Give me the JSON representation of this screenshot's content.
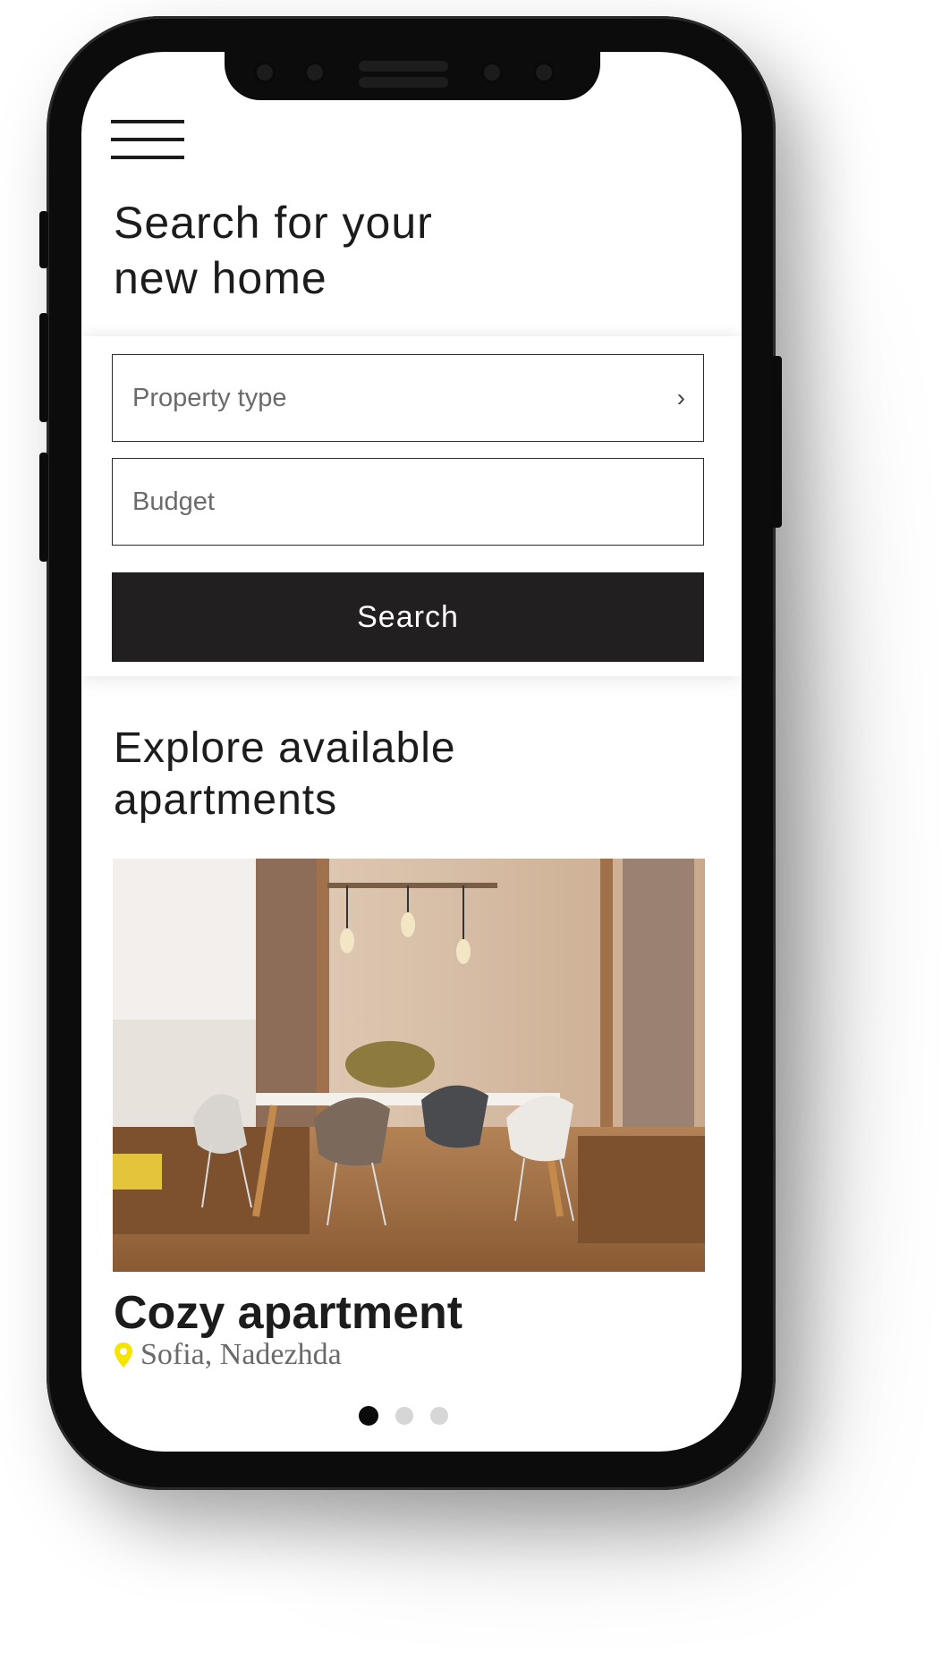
{
  "header": {
    "title_line1": "Search for your",
    "title_line2": "new home"
  },
  "search": {
    "property_type_placeholder": "Property type",
    "budget_placeholder": "Budget",
    "button_label": "Search"
  },
  "explore": {
    "title_line1": "Explore available",
    "title_line2": "apartments"
  },
  "listing": {
    "name": "Cozy apartment",
    "location": "Sofia, Nadezhda",
    "image_icon": "apartment-photo"
  },
  "carousel": {
    "active_index": 0,
    "count": 3
  },
  "colors": {
    "button_bg": "#221f20",
    "pin": "#f5e400",
    "dot_active": "#0b0b0b",
    "dot_inactive": "#d6d6d6"
  }
}
